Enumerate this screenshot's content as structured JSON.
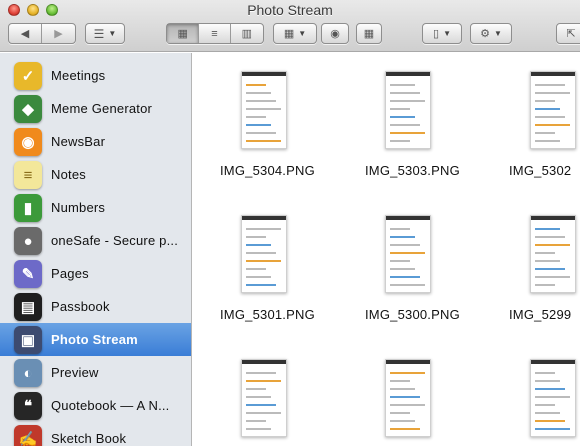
{
  "window": {
    "title": "Photo Stream"
  },
  "sidebar": {
    "items": [
      {
        "label": "Meetings",
        "icon": "meetings-icon",
        "color": "#e8b82a",
        "glyph": "✓"
      },
      {
        "label": "Meme Generator",
        "icon": "meme-generator-icon",
        "color": "#3b8a3e",
        "glyph": "◆"
      },
      {
        "label": "NewsBar",
        "icon": "newsbar-icon",
        "color": "#f08a1c",
        "glyph": "◉"
      },
      {
        "label": "Notes",
        "icon": "notes-icon",
        "color": "#f3e79a",
        "glyph": "≡"
      },
      {
        "label": "Numbers",
        "icon": "numbers-icon",
        "color": "#3c9a3a",
        "glyph": "▮"
      },
      {
        "label": "oneSafe - Secure p...",
        "icon": "onesafe-icon",
        "color": "#6a6a6a",
        "glyph": "●"
      },
      {
        "label": "Pages",
        "icon": "pages-icon",
        "color": "#6d6ac8",
        "glyph": "✎"
      },
      {
        "label": "Passbook",
        "icon": "passbook-icon",
        "color": "#1f1f1f",
        "glyph": "▤"
      },
      {
        "label": "Photo Stream",
        "icon": "photo-stream-icon",
        "color": "#3d4b70",
        "glyph": "▣",
        "selected": true
      },
      {
        "label": "Preview",
        "icon": "preview-icon",
        "color": "#6a8fb4",
        "glyph": "◐"
      },
      {
        "label": "Quotebook — A N...",
        "icon": "quotebook-icon",
        "color": "#262626",
        "glyph": "❝"
      },
      {
        "label": "Sketch Book",
        "icon": "sketchbook-icon",
        "color": "#c0392b",
        "glyph": "✍"
      }
    ]
  },
  "files": [
    {
      "name": "IMG_5304.PNG"
    },
    {
      "name": "IMG_5303.PNG"
    },
    {
      "name": "IMG_5302"
    },
    {
      "name": "IMG_5301.PNG"
    },
    {
      "name": "IMG_5300.PNG"
    },
    {
      "name": "IMG_5299"
    },
    {
      "name": ""
    },
    {
      "name": ""
    },
    {
      "name": ""
    }
  ]
}
